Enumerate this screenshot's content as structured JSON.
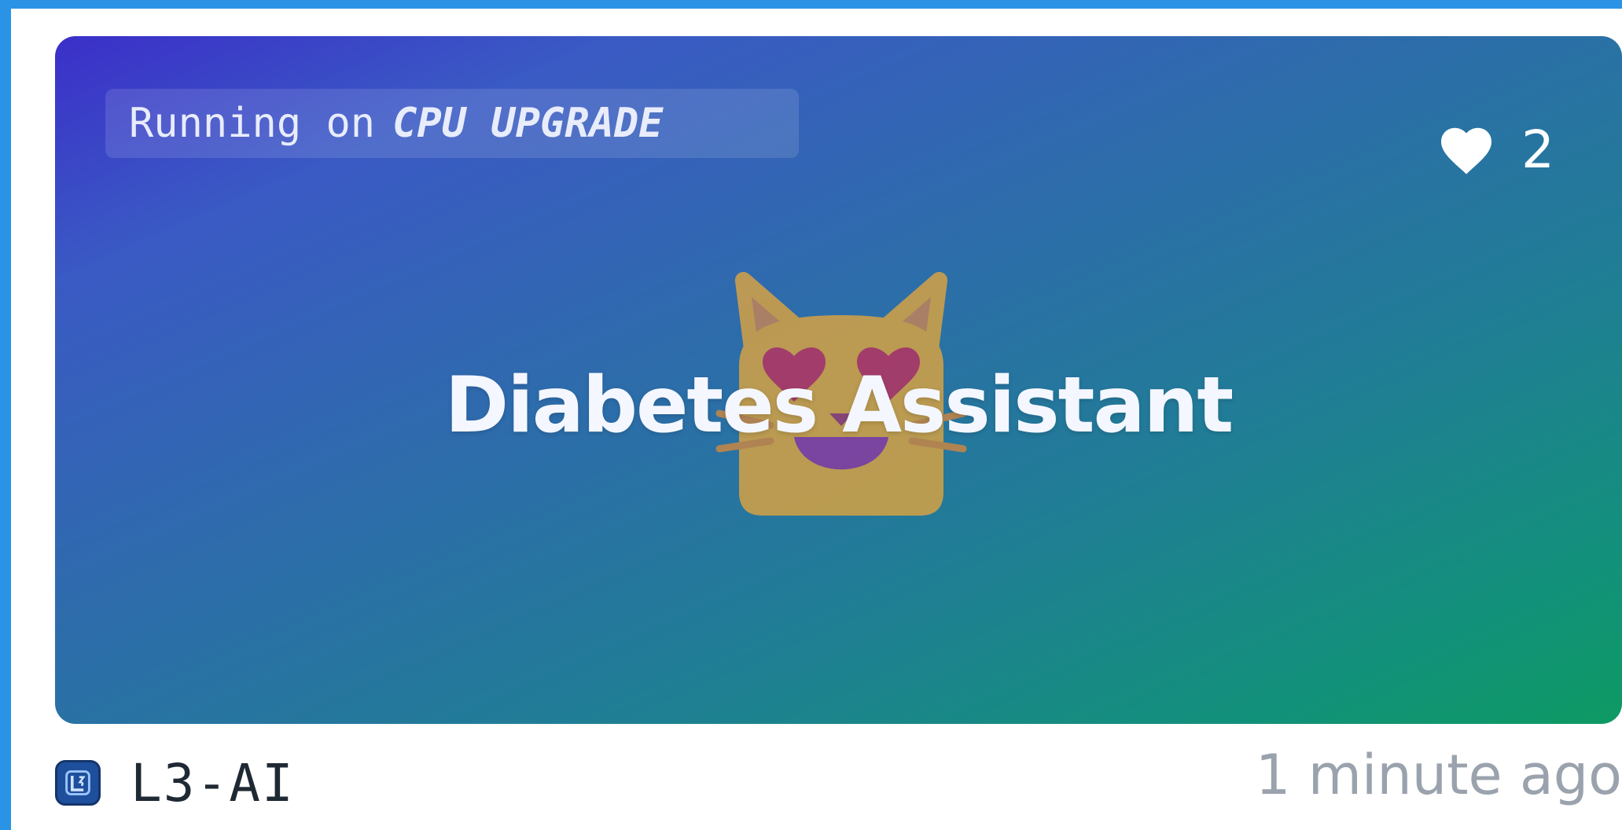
{
  "space_card": {
    "hardware": {
      "prefix": "Running on",
      "value": "CPU UPGRADE"
    },
    "likes": {
      "icon": "heart-icon",
      "count": "2"
    },
    "emoji": "smiling-cat-with-heart-eyes",
    "title": "Diabetes Assistant",
    "author": {
      "avatar_icon": "organization-avatar-icon",
      "name": "L3-AI"
    },
    "updated": "1 minute ago"
  },
  "colors": {
    "banner_gradient_start": "#3b2fc9",
    "banner_gradient_end": "#0d9a63",
    "page_frame": "#2a93e6"
  }
}
